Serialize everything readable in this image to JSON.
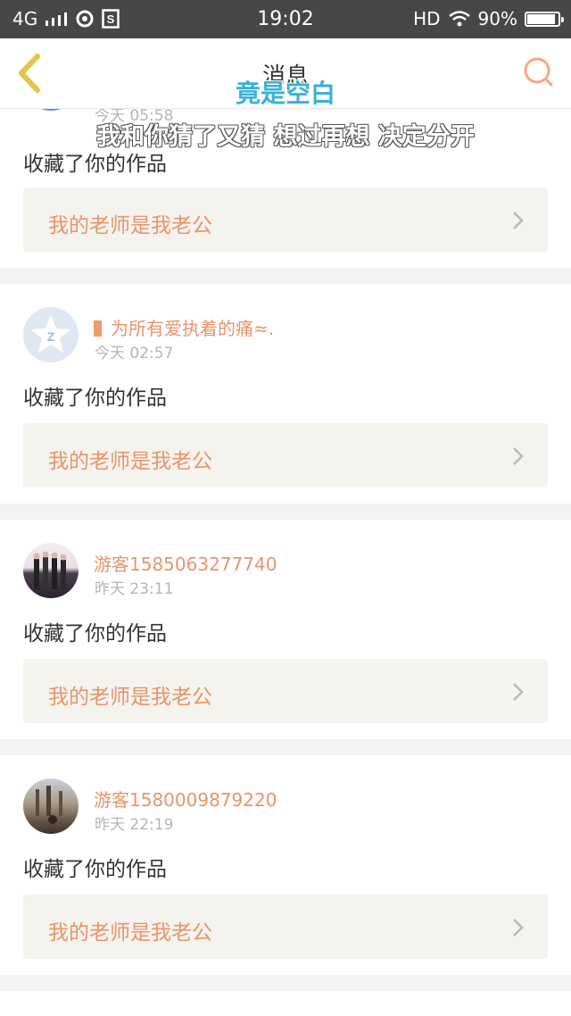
{
  "status_bar": {
    "network": "4G",
    "time": "19:02",
    "hd": "HD",
    "battery": "90%",
    "battery_level": 0.9
  },
  "header": {
    "title": "消息",
    "back_icon": "chevron-left-icon",
    "search_icon": "search-icon"
  },
  "overlay": {
    "caption_top": "竟是空白",
    "caption_bottom": "我和你猜了又猜 想过再想 决定分开"
  },
  "colors": {
    "accent": "#e8946a",
    "back_icon": "#e2c64a",
    "search_icon": "#f4a983"
  },
  "messages": [
    {
      "username": "",
      "time": "今天 05:58",
      "action": "收藏了你的作品",
      "work_title": "我的老师是我老公"
    },
    {
      "username": "为所有爱执着的痛≈.",
      "time": "今天 02:57",
      "action": "收藏了你的作品",
      "work_title": "我的老师是我老公"
    },
    {
      "username": "游客1585063277740",
      "time": "昨天 23:11",
      "action": "收藏了你的作品",
      "work_title": "我的老师是我老公"
    },
    {
      "username": "游客1580009879220",
      "time": "昨天 22:19",
      "action": "收藏了你的作品",
      "work_title": "我的老师是我老公"
    }
  ]
}
